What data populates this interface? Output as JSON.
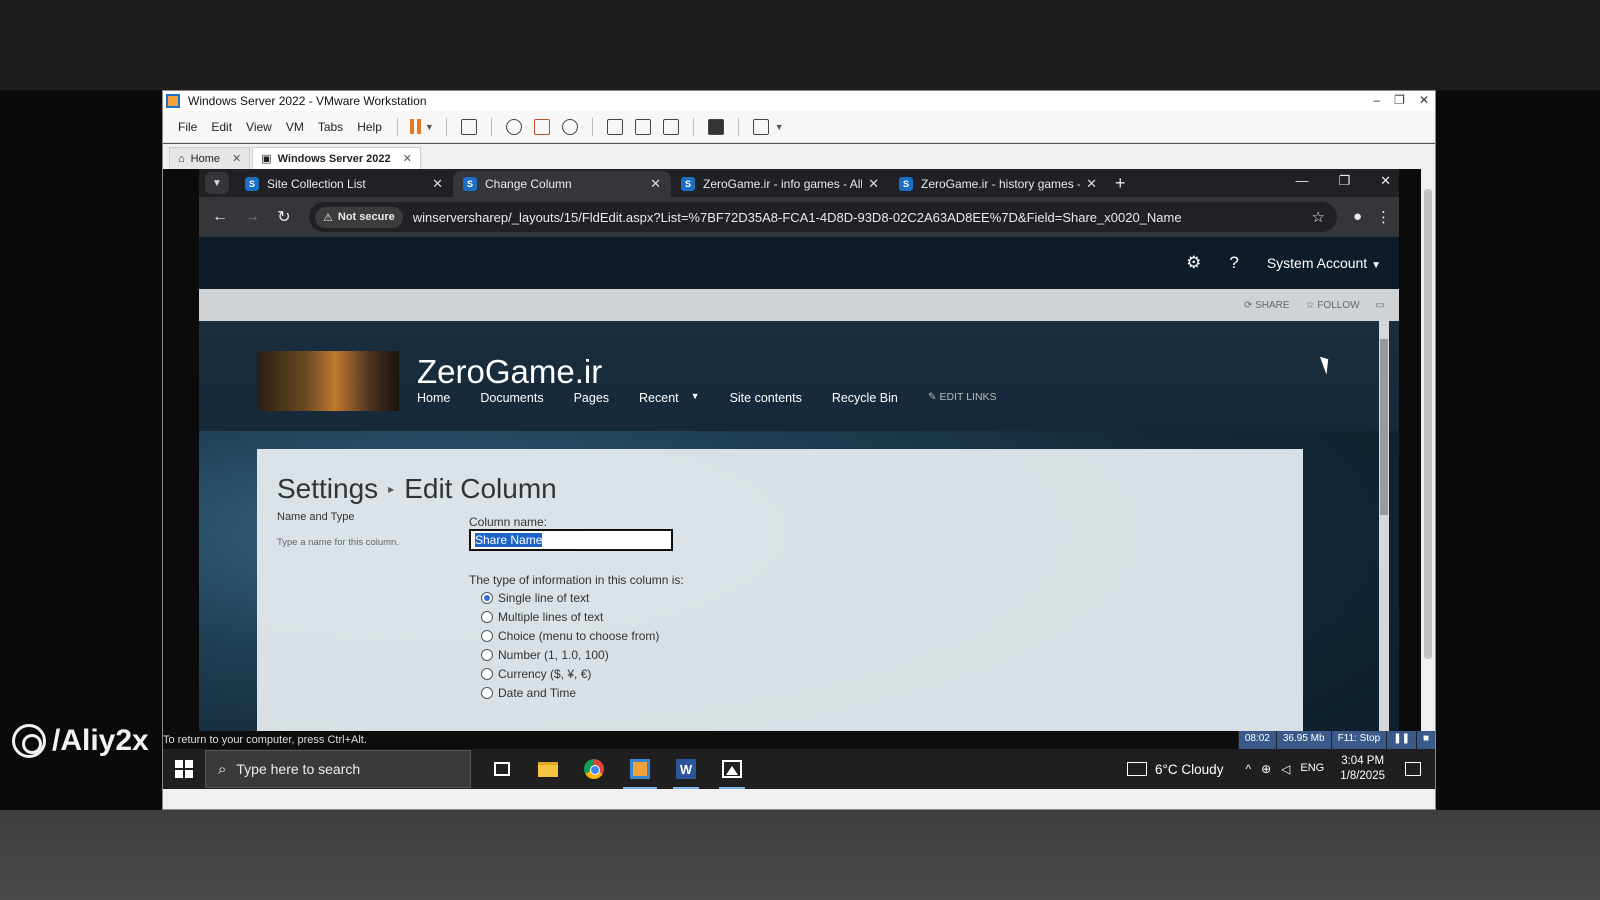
{
  "vmware": {
    "title": "Windows Server 2022 - VMware Workstation",
    "menu": [
      "File",
      "Edit",
      "View",
      "VM",
      "Tabs",
      "Help"
    ],
    "tabs": [
      {
        "label": "Home",
        "icon": "home-icon"
      },
      {
        "label": "Windows Server 2022",
        "icon": "vm-icon"
      }
    ],
    "status_hint": "To return to your computer, press Ctrl+Alt.",
    "recorder": {
      "time": "08:02",
      "size": "36.95 Mb",
      "stop": "F11: Stop"
    }
  },
  "chrome": {
    "tabs": [
      {
        "title": "Site Collection List",
        "active": false
      },
      {
        "title": "Change Column",
        "active": true
      },
      {
        "title": "ZeroGame.ir - info games - All I",
        "active": false
      },
      {
        "title": "ZeroGame.ir - history games - /",
        "active": false
      }
    ],
    "not_secure": "Not secure",
    "url": "winserversharep/_layouts/15/FldEdit.aspx?List=%7BF72D35A8-FCA1-4D8D-93D8-02C2A63AD8EE%7D&Field=Share_x0020_Name"
  },
  "sharepoint": {
    "account": "System Account",
    "ribbon": {
      "share": "SHARE",
      "follow": "FOLLOW"
    },
    "site_title": "ZeroGame.ir",
    "nav": [
      "Home",
      "Documents",
      "Pages",
      "Recent",
      "Site contents",
      "Recycle Bin"
    ],
    "edit_links": "EDIT LINKS",
    "page_title": {
      "part1": "Settings",
      "part2": "Edit Column"
    },
    "section_heading": "Name and Type",
    "section_desc": "Type a name for this column.",
    "column_name_label": "Column name:",
    "column_name_value": "Share Name",
    "type_label": "The type of information in this column is:",
    "types": [
      {
        "label": "Single line of text",
        "selected": true
      },
      {
        "label": "Multiple lines of text",
        "selected": false
      },
      {
        "label": "Choice (menu to choose from)",
        "selected": false
      },
      {
        "label": "Number (1, 1.0, 100)",
        "selected": false
      },
      {
        "label": "Currency ($, ¥, €)",
        "selected": false
      },
      {
        "label": "Date and Time",
        "selected": false
      }
    ]
  },
  "taskbar": {
    "search_placeholder": "Type here to search",
    "weather": "6°C  Cloudy",
    "lang": "ENG",
    "time": "3:04 PM",
    "date": "1/8/2025"
  },
  "watermark": "/Aliy2x"
}
